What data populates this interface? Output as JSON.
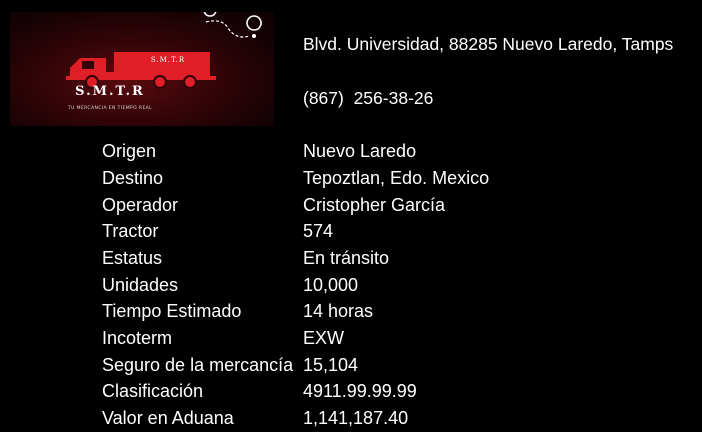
{
  "logo": {
    "title": "S.M.T.R",
    "truck_label": "S.M.T.R",
    "tagline": "TU MERCANCIA EN TIEMPO REAL",
    "colors": {
      "truck": "#e01e26",
      "background": "#3a060a",
      "route": "#ffffff"
    },
    "icons": [
      "truck-icon",
      "route-pin-icon"
    ]
  },
  "contact": {
    "address": "Blvd. Universidad, 88285 Nuevo Laredo, Tamps",
    "phone": "(867)  256-38-26"
  },
  "details": [
    {
      "label": "Origen",
      "value": "Nuevo Laredo"
    },
    {
      "label": "Destino",
      "value": "Tepoztlan, Edo. Mexico"
    },
    {
      "label": "Operador",
      "value": "Cristopher García"
    },
    {
      "label": "Tractor",
      "value": "574"
    },
    {
      "label": "Estatus",
      "value": "En tránsito"
    },
    {
      "label": "Unidades",
      "value": "10,000"
    },
    {
      "label": "Tiempo Estimado",
      "value": "14 horas"
    },
    {
      "label": "Incoterm",
      "value": "EXW"
    },
    {
      "label": "Seguro de la mercancía",
      "value": "15,104"
    },
    {
      "label": "Clasificación",
      "value": "4911.99.99.99"
    },
    {
      "label": "Valor en Aduana",
      "value": "1,141,187.40"
    }
  ]
}
